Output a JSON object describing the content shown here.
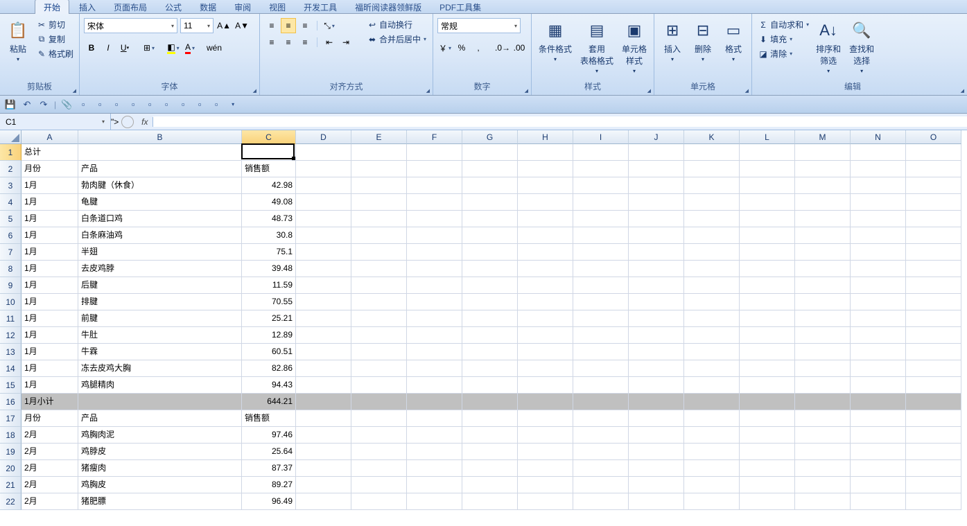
{
  "tabs": [
    "开始",
    "插入",
    "页面布局",
    "公式",
    "数据",
    "审阅",
    "视图",
    "开发工具",
    "福昕阅读器领鲜版",
    "PDF工具集"
  ],
  "active_tab": 0,
  "ribbon": {
    "clipboard": {
      "paste": "粘贴",
      "cut": "剪切",
      "copy": "复制",
      "format_painter": "格式刷",
      "label": "剪贴板"
    },
    "font": {
      "name": "宋体",
      "size": "11",
      "label": "字体"
    },
    "align": {
      "wrap": "自动换行",
      "merge": "合并后居中",
      "label": "对齐方式"
    },
    "number": {
      "format": "常规",
      "label": "数字"
    },
    "styles": {
      "cond": "条件格式",
      "table": "套用\n表格格式",
      "cell": "单元格\n样式",
      "label": "样式"
    },
    "cells": {
      "insert": "插入",
      "delete": "删除",
      "format": "格式",
      "label": "单元格"
    },
    "editing": {
      "sum": "自动求和",
      "fill": "填充",
      "clear": "清除",
      "sort": "排序和\n筛选",
      "find": "查找和\n选择",
      "label": "编辑"
    }
  },
  "name_box": "C1",
  "fx_value": "",
  "columns": [
    "A",
    "B",
    "C",
    "D",
    "E",
    "F",
    "G",
    "H",
    "I",
    "J",
    "K",
    "L",
    "M",
    "N",
    "O"
  ],
  "col_widths": {
    "A": 82,
    "B": 236,
    "C": 78,
    "other": 80
  },
  "active": {
    "col": "C",
    "row": 1
  },
  "visible_rows": 22,
  "rows": [
    {
      "n": 1,
      "a": "总计",
      "b": "",
      "c": ""
    },
    {
      "n": 2,
      "a": "月份",
      "b": "产品",
      "c": "销售额"
    },
    {
      "n": 3,
      "a": "1月",
      "b": "勃肉腱（休食）",
      "c": "42.98"
    },
    {
      "n": 4,
      "a": "1月",
      "b": "龟腱",
      "c": "49.08"
    },
    {
      "n": 5,
      "a": "1月",
      "b": "白条道口鸡",
      "c": "48.73"
    },
    {
      "n": 6,
      "a": "1月",
      "b": "白条麻油鸡",
      "c": "30.8"
    },
    {
      "n": 7,
      "a": "1月",
      "b": "半翅",
      "c": "75.1"
    },
    {
      "n": 8,
      "a": "1月",
      "b": "去皮鸡脖",
      "c": "39.48"
    },
    {
      "n": 9,
      "a": "1月",
      "b": "后腱",
      "c": "11.59"
    },
    {
      "n": 10,
      "a": "1月",
      "b": "排腱",
      "c": "70.55"
    },
    {
      "n": 11,
      "a": "1月",
      "b": "前腱",
      "c": "25.21"
    },
    {
      "n": 12,
      "a": "1月",
      "b": "牛肚",
      "c": "12.89"
    },
    {
      "n": 13,
      "a": "1月",
      "b": "牛霖",
      "c": "60.51"
    },
    {
      "n": 14,
      "a": "1月",
      "b": "冻去皮鸡大胸",
      "c": "82.86"
    },
    {
      "n": 15,
      "a": "1月",
      "b": "鸡腿精肉",
      "c": "94.43"
    },
    {
      "n": 16,
      "a": "1月小计",
      "b": "",
      "c": "644.21",
      "subtotal": true
    },
    {
      "n": 17,
      "a": "月份",
      "b": "产品",
      "c": "销售额"
    },
    {
      "n": 18,
      "a": "2月",
      "b": "鸡胸肉泥",
      "c": "97.46"
    },
    {
      "n": 19,
      "a": "2月",
      "b": "鸡脖皮",
      "c": "25.64"
    },
    {
      "n": 20,
      "a": "2月",
      "b": "猪瘦肉",
      "c": "87.37"
    },
    {
      "n": 21,
      "a": "2月",
      "b": "鸡胸皮",
      "c": "89.27"
    },
    {
      "n": 22,
      "a": "2月",
      "b": "猪肥膘",
      "c": "96.49"
    }
  ]
}
